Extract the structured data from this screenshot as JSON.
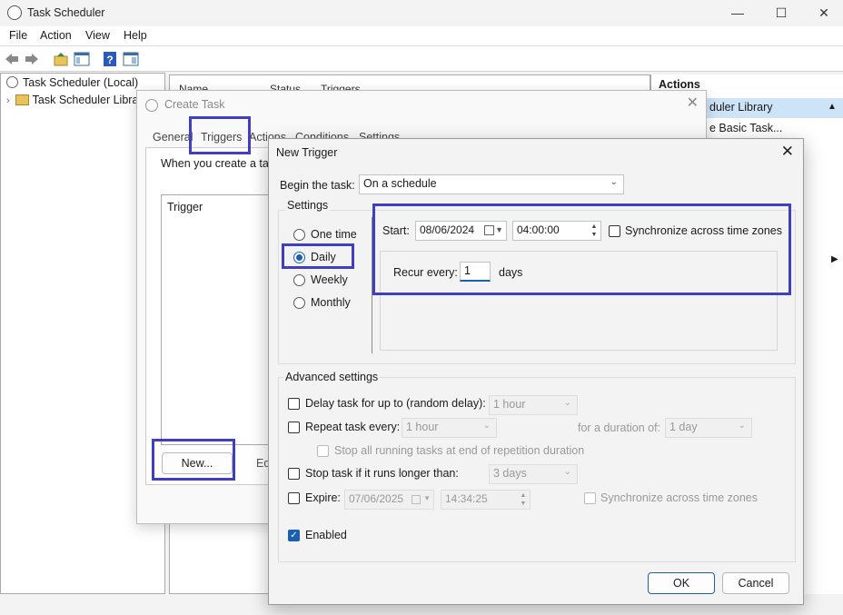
{
  "window": {
    "title": "Task Scheduler",
    "controls": [
      "—",
      "☐",
      "✕"
    ]
  },
  "menu": [
    "File",
    "Action",
    "View",
    "Help"
  ],
  "tree": {
    "root": "Task Scheduler (Local)",
    "child": "Task Scheduler Libra"
  },
  "center_headers": [
    "Name",
    "Status",
    "Triggers"
  ],
  "actions_pane": {
    "header": "Actions",
    "selected": "duler Library",
    "items": [
      "e Basic Task..."
    ]
  },
  "create_task": {
    "title": "Create Task",
    "tabs": [
      "General",
      "Triggers",
      "Actions",
      "Conditions",
      "Settings"
    ],
    "intro": "When you create a task",
    "list_header": "Trigger",
    "new_button": "New...",
    "edit_button": "Ed"
  },
  "new_trigger": {
    "title": "New Trigger",
    "begin_label": "Begin the task:",
    "begin_value": "On a schedule",
    "settings_label": "Settings",
    "schedule_options": [
      "One time",
      "Daily",
      "Weekly",
      "Monthly"
    ],
    "selected_option": "Daily",
    "start_label": "Start:",
    "start_date": "08/06/2024",
    "start_time": "04:00:00",
    "sync_label": "Synchronize across time zones",
    "recur_label": "Recur every:",
    "recur_value": "1",
    "recur_unit": "days",
    "advanced_label": "Advanced settings",
    "delay_label": "Delay task for up to (random delay):",
    "delay_value": "1 hour",
    "repeat_label": "Repeat task every:",
    "repeat_value": "1 hour",
    "duration_label": "for a duration of:",
    "duration_value": "1 day",
    "stop_all_label": "Stop all running tasks at end of repetition duration",
    "stop_longer_label": "Stop task if it runs longer than:",
    "stop_longer_value": "3 days",
    "expire_label": "Expire:",
    "expire_date": "07/06/2025",
    "expire_time": "14:34:25",
    "expire_sync_label": "Synchronize across time zones",
    "enabled_label": "Enabled",
    "ok_label": "OK",
    "cancel_label": "Cancel"
  },
  "colors": {
    "highlight": "#3f3fbf",
    "accent": "#1a5fb4",
    "selection": "#cde3f7"
  }
}
